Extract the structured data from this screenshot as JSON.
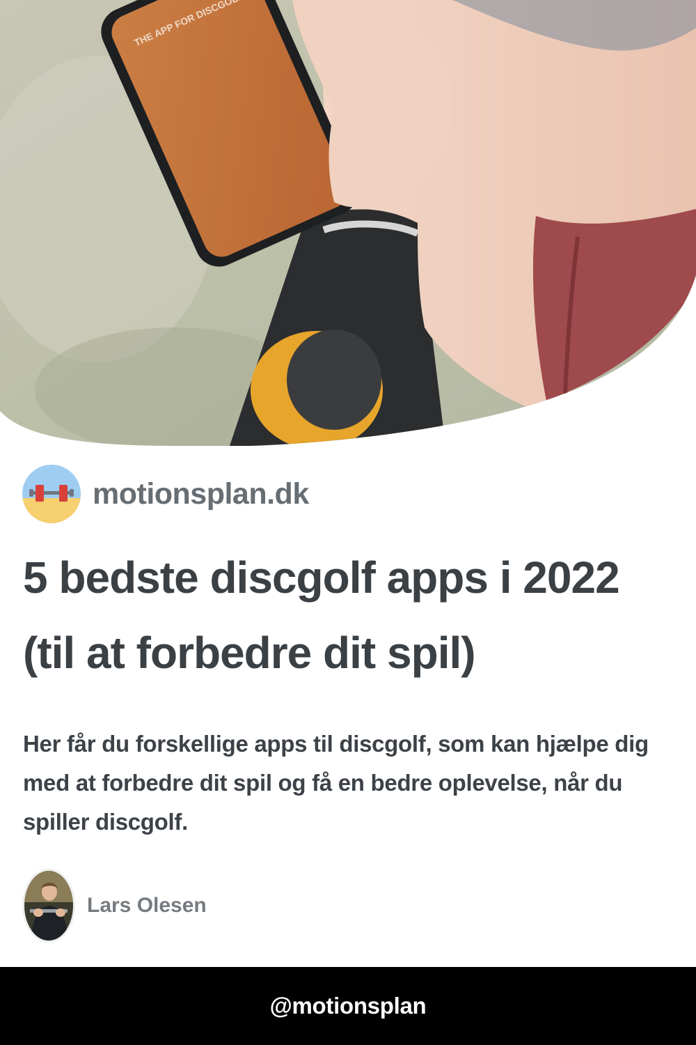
{
  "hero": {
    "phone_screen_text": "THE APP FOR DISCGOLF"
  },
  "site": {
    "name": "motionsplan.dk",
    "logo_icon": "barbell-on-beach-icon"
  },
  "article": {
    "title": "5 bedste discgolf apps i 2022 (til at forbedre dit spil)",
    "description": "Her får du forskellige apps til discgolf, som kan hjælpe dig med at forbedre dit spil og få en bedre oplevelse, når du spiller discgolf."
  },
  "author": {
    "name": "Lars Olesen"
  },
  "footer": {
    "handle": "@motionsplan"
  },
  "colors": {
    "title": "#3b4045",
    "site_name": "#666d73",
    "author_name": "#767b80",
    "footer_bg": "#000000",
    "footer_text": "#ffffff"
  }
}
